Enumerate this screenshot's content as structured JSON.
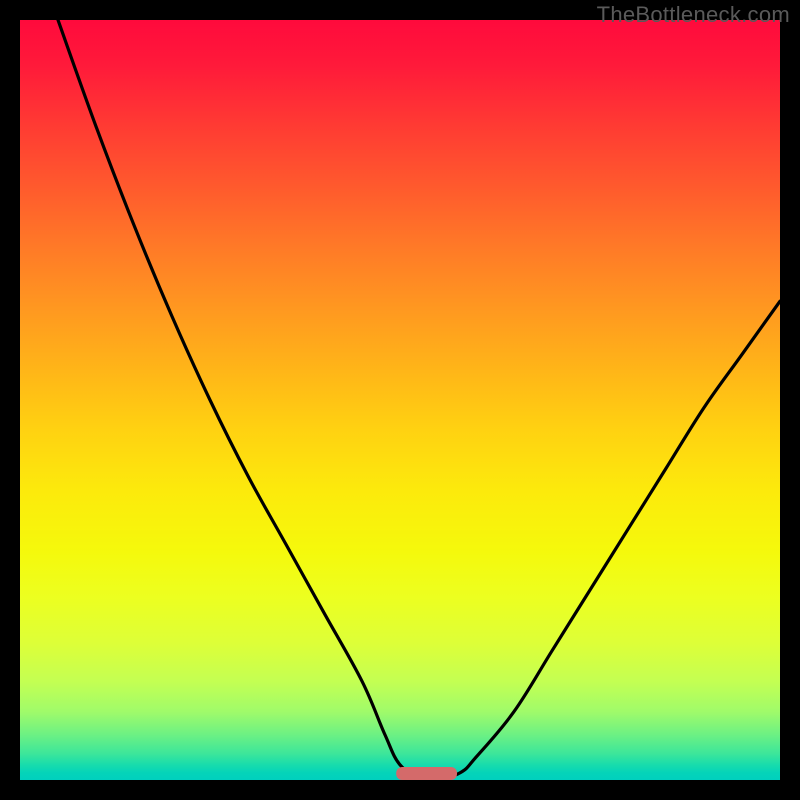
{
  "watermark": "TheBottleneck.com",
  "chart_data": {
    "type": "line",
    "title": "",
    "xlabel": "",
    "ylabel": "",
    "xlim": [
      0,
      100
    ],
    "ylim": [
      0,
      100
    ],
    "grid": false,
    "legend": false,
    "background_gradient": {
      "direction": "vertical",
      "stops": [
        {
          "pos": 0,
          "color": "#ff0a3c"
        },
        {
          "pos": 50,
          "color": "#ffd211"
        },
        {
          "pos": 100,
          "color": "#00d0be"
        }
      ]
    },
    "series": [
      {
        "name": "bottleneck-curve",
        "color": "#000000",
        "x": [
          5,
          10,
          15,
          20,
          25,
          30,
          35,
          40,
          45,
          48,
          50,
          53,
          55,
          58,
          60,
          65,
          70,
          75,
          80,
          85,
          90,
          95,
          100
        ],
        "values": [
          100,
          86,
          73,
          61,
          50,
          40,
          31,
          22,
          13,
          6,
          2,
          0,
          0,
          1,
          3,
          9,
          17,
          25,
          33,
          41,
          49,
          56,
          63
        ]
      }
    ],
    "marker": {
      "name": "optimal-region",
      "shape": "rounded-rect",
      "x_center": 53.5,
      "y": 0,
      "width": 8,
      "color": "#d46a6a"
    }
  }
}
